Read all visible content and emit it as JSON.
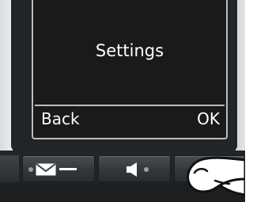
{
  "screen": {
    "title": "Settings",
    "soft_left": "Back",
    "soft_right": "OK"
  },
  "keys": {
    "left_icons": [
      "dot-icon",
      "envelope-icon",
      "dash-icon"
    ],
    "middle_icons": [
      "speaker-icon",
      "dot-icon"
    ]
  },
  "colors": {
    "screen_bg": "#1a1a1a",
    "screen_text": "#ffffff",
    "frame": "#b9bec1",
    "phone_body": "#2c2f32"
  }
}
